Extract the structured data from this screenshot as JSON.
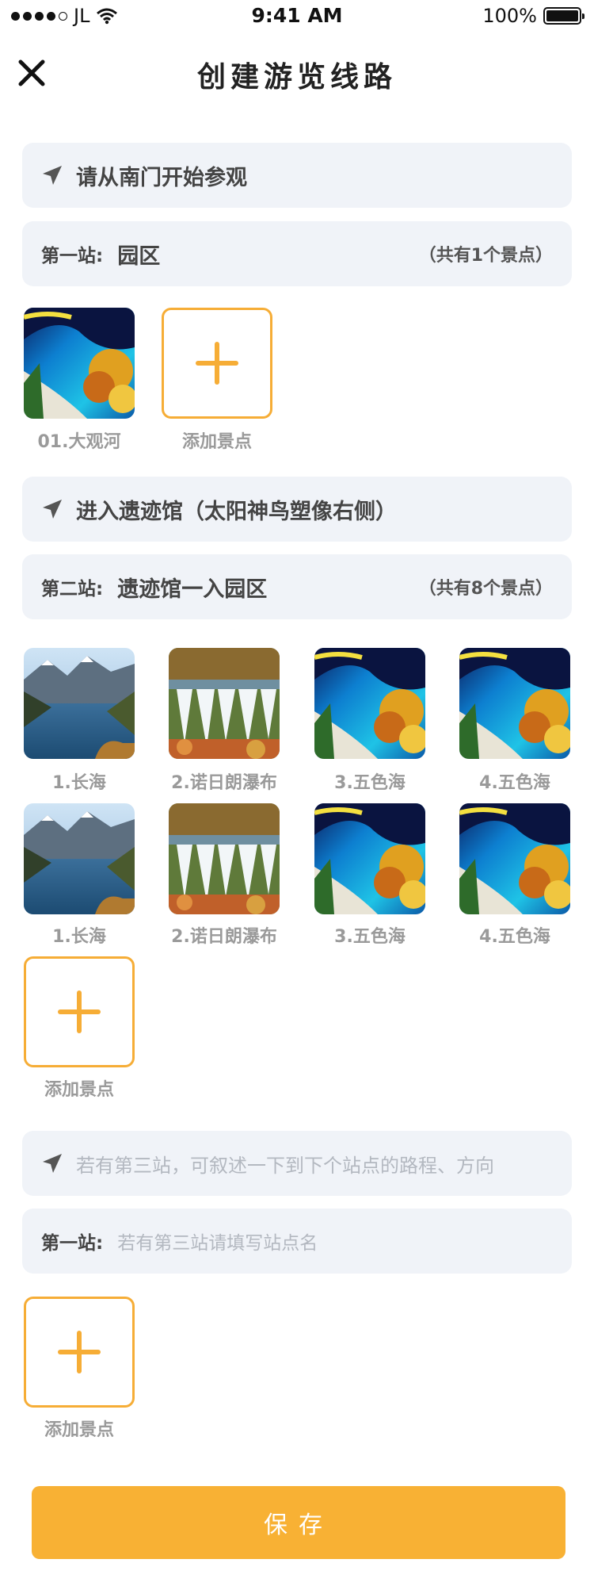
{
  "status": {
    "carrier": "JL",
    "time": "9:41 AM",
    "battery": "100%"
  },
  "header": {
    "title": "创建游览线路"
  },
  "route1": {
    "direction": "请从南门开始参观",
    "station_label": "第一站:",
    "station_name": "园区",
    "count": "（共有1个景点）",
    "spots": [
      {
        "caption": "01.大观河",
        "image": "colorful-lake"
      }
    ],
    "add_label": "添加景点"
  },
  "route2": {
    "direction": "进入遗迹馆（太阳神鸟塑像右侧）",
    "station_label": "第二站:",
    "station_name": "遗迹馆一入园区",
    "count": "（共有8个景点）",
    "spots": [
      {
        "caption": "1.长海",
        "image": "mountain-lake"
      },
      {
        "caption": "2.诺日朗瀑布",
        "image": "waterfall"
      },
      {
        "caption": "3.五色海",
        "image": "colorful-lake"
      },
      {
        "caption": "4.五色海",
        "image": "colorful-lake"
      },
      {
        "caption": "1.长海",
        "image": "mountain-lake"
      },
      {
        "caption": "2.诺日朗瀑布",
        "image": "waterfall"
      },
      {
        "caption": "3.五色海",
        "image": "colorful-lake"
      },
      {
        "caption": "4.五色海",
        "image": "colorful-lake"
      }
    ],
    "add_label": "添加景点"
  },
  "route3": {
    "direction_placeholder": "若有第三站，可叙述一下到下个站点的路程、方向",
    "station_label": "第一站:",
    "station_placeholder": "若有第三站请填写站点名",
    "add_label": "添加景点"
  },
  "save_label": "保存",
  "colors": {
    "accent": "#f8b134",
    "bar_bg": "#f0f3f8"
  }
}
